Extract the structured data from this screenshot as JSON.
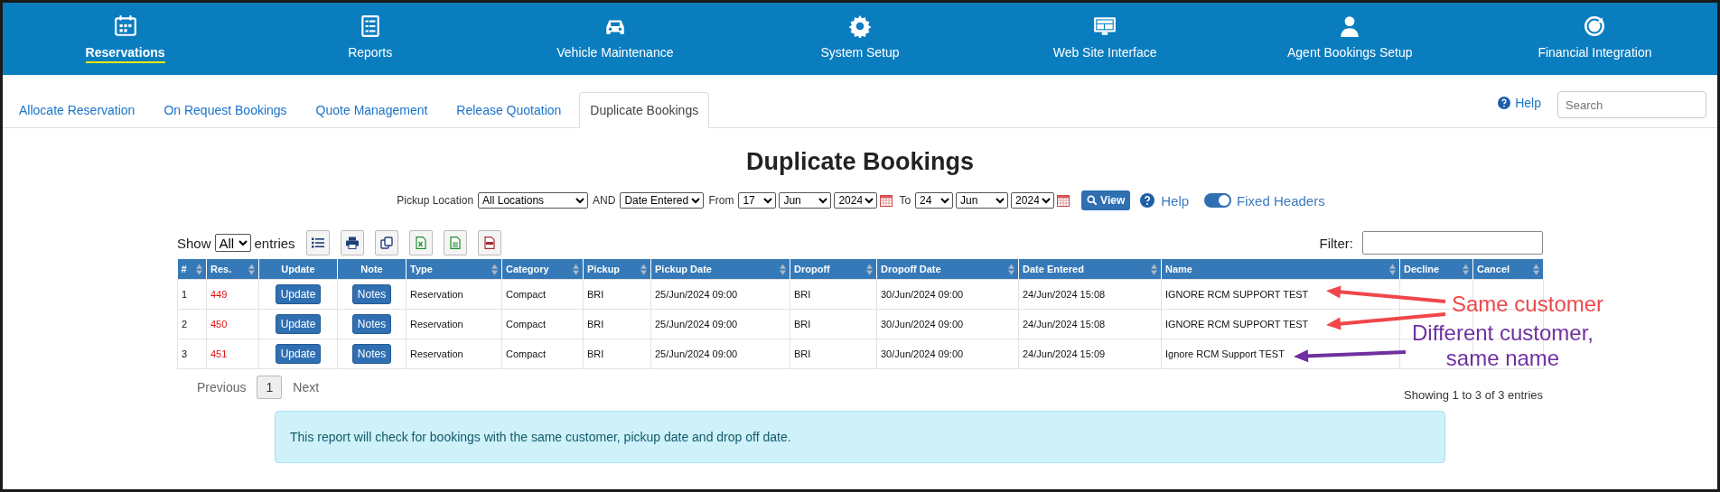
{
  "nav": [
    {
      "label": "Reservations",
      "selected": true
    },
    {
      "label": "Reports",
      "selected": false
    },
    {
      "label": "Vehicle Maintenance",
      "selected": false
    },
    {
      "label": "System Setup",
      "selected": false
    },
    {
      "label": "Web Site Interface",
      "selected": false
    },
    {
      "label": "Agent Bookings Setup",
      "selected": false
    },
    {
      "label": "Financial Integration",
      "selected": false
    }
  ],
  "tabs": [
    {
      "label": "Allocate Reservation",
      "selected": false
    },
    {
      "label": "On Request Bookings",
      "selected": false
    },
    {
      "label": "Quote Management",
      "selected": false
    },
    {
      "label": "Release Quotation",
      "selected": false
    },
    {
      "label": "Duplicate Bookings",
      "selected": true
    }
  ],
  "help_link": "Help",
  "search": {
    "placeholder": "Search"
  },
  "title": "Duplicate Bookings",
  "filters": {
    "pickup_label": "Pickup Location",
    "location": "All Locations",
    "and_label": "AND",
    "date_type": "Date Entered",
    "from_label": "From",
    "from": [
      "17",
      "Jun",
      "2024"
    ],
    "to_label": "To",
    "to": [
      "24",
      "Jun",
      "2024"
    ],
    "view_button": "View",
    "help": "Help",
    "fixed_headers": {
      "label": "Fixed Headers",
      "on": true
    }
  },
  "toolbar": {
    "show_label": "Show",
    "show_value": "All",
    "entries_label": "entries",
    "filter_label": "Filter:"
  },
  "table": {
    "columns": [
      {
        "label": "#",
        "sortable": true
      },
      {
        "label": "Res.",
        "sortable": true
      },
      {
        "label": "Update",
        "sortable": false
      },
      {
        "label": "Note",
        "sortable": false
      },
      {
        "label": "Type",
        "sortable": true
      },
      {
        "label": "Category",
        "sortable": true
      },
      {
        "label": "Pickup",
        "sortable": true
      },
      {
        "label": "Pickup Date",
        "sortable": true
      },
      {
        "label": "Dropoff",
        "sortable": true
      },
      {
        "label": "Dropoff Date",
        "sortable": true
      },
      {
        "label": "Date Entered",
        "sortable": true
      },
      {
        "label": "Name",
        "sortable": true
      },
      {
        "label": "Decline",
        "sortable": true
      },
      {
        "label": "Cancel",
        "sortable": true
      }
    ],
    "rows": [
      {
        "num": "1",
        "res": "449",
        "update": "Update",
        "notes": "Notes",
        "type": "Reservation",
        "category": "Compact",
        "pickup": "BRI",
        "pickup_date": "25/Jun/2024 09:00",
        "dropoff": "BRI",
        "dropoff_date": "30/Jun/2024 09:00",
        "date_entered": "24/Jun/2024 15:08",
        "name": "IGNORE RCM SUPPORT TEST"
      },
      {
        "num": "2",
        "res": "450",
        "update": "Update",
        "notes": "Notes",
        "type": "Reservation",
        "category": "Compact",
        "pickup": "BRI",
        "pickup_date": "25/Jun/2024 09:00",
        "dropoff": "BRI",
        "dropoff_date": "30/Jun/2024 09:00",
        "date_entered": "24/Jun/2024 15:08",
        "name": "IGNORE RCM SUPPORT TEST"
      },
      {
        "num": "3",
        "res": "451",
        "update": "Update",
        "notes": "Notes",
        "type": "Reservation",
        "category": "Compact",
        "pickup": "BRI",
        "pickup_date": "25/Jun/2024 09:00",
        "dropoff": "BRI",
        "dropoff_date": "30/Jun/2024 09:00",
        "date_entered": "24/Jun/2024 15:09",
        "name": "Ignore RCM Support TEST"
      }
    ]
  },
  "pagination": {
    "previous": "Previous",
    "pages": [
      {
        "label": "1",
        "selected": true
      }
    ],
    "next": "Next",
    "summary": "Showing 1 to 3 of 3 entries"
  },
  "info": "This report will check for bookings with the same customer, pickup date and drop off date.",
  "annotations": [
    {
      "lines": [
        "Same customer"
      ],
      "color": "#f0474a"
    },
    {
      "lines": [
        "Different customer,",
        "same name"
      ],
      "color": "#7030a0"
    }
  ]
}
